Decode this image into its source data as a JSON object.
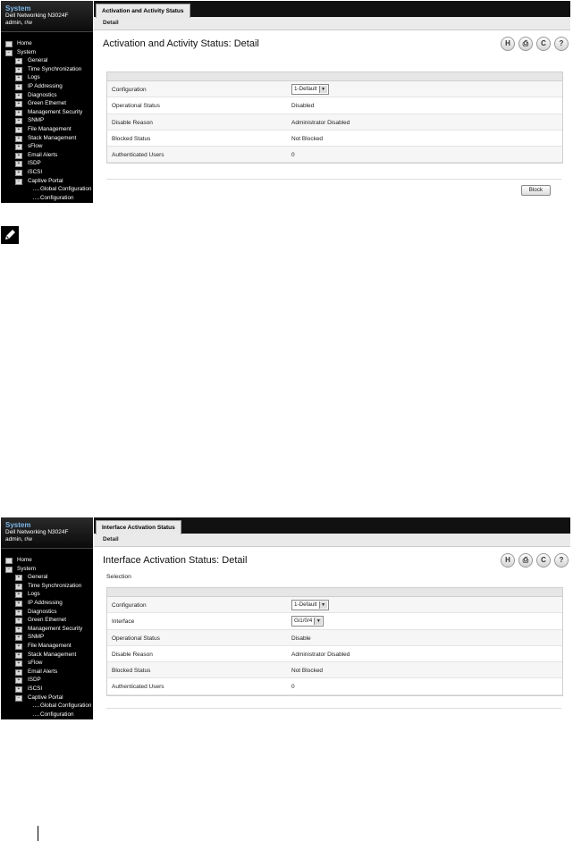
{
  "screens": [
    {
      "sidebar": {
        "title": "System",
        "device": "Dell Networking N3024F",
        "user": "admin, r/w",
        "items": [
          {
            "label": "Home",
            "level": 0,
            "icon": "home-icon"
          },
          {
            "label": "System",
            "level": 0,
            "icon": "minus-icon"
          },
          {
            "label": "General",
            "level": 1,
            "icon": "plus-icon"
          },
          {
            "label": "Time Synchronization",
            "level": 1,
            "icon": "plus-icon"
          },
          {
            "label": "Logs",
            "level": 1,
            "icon": "plus-icon"
          },
          {
            "label": "IP Addressing",
            "level": 1,
            "icon": "plus-icon"
          },
          {
            "label": "Diagnostics",
            "level": 1,
            "icon": "plus-icon"
          },
          {
            "label": "Green Ethernet",
            "level": 1,
            "icon": "plus-icon"
          },
          {
            "label": "Management Security",
            "level": 1,
            "icon": "plus-icon"
          },
          {
            "label": "SNMP",
            "level": 1,
            "icon": "plus-icon"
          },
          {
            "label": "File Management",
            "level": 1,
            "icon": "plus-icon"
          },
          {
            "label": "Stack Management",
            "level": 1,
            "icon": "plus-icon"
          },
          {
            "label": "sFlow",
            "level": 1,
            "icon": "plus-icon"
          },
          {
            "label": "Email Alerts",
            "level": 1,
            "icon": "plus-icon"
          },
          {
            "label": "ISDP",
            "level": 1,
            "icon": "plus-icon"
          },
          {
            "label": "iSCSI",
            "level": 1,
            "icon": "plus-icon"
          },
          {
            "label": "Captive Portal",
            "level": 1,
            "icon": "minus-icon"
          },
          {
            "label": "Global Configuration",
            "level": 2,
            "icon": ""
          },
          {
            "label": "Configuration",
            "level": 2,
            "icon": ""
          }
        ]
      },
      "tab": "Activation and Activity Status",
      "subtab": "Detail",
      "page_title": "Activation and Activity Status: Detail",
      "section_label": "",
      "rows": [
        {
          "key": "Configuration",
          "value": "1-Default",
          "type": "select"
        },
        {
          "key": "Operational Status",
          "value": "Disabled",
          "type": "text"
        },
        {
          "key": "Disable Reason",
          "value": "Administrator Disabled",
          "type": "text"
        },
        {
          "key": "Blocked Status",
          "value": "Not Blocked",
          "type": "text"
        },
        {
          "key": "Authenticated Users",
          "value": "0",
          "type": "text"
        }
      ],
      "button": "Block"
    },
    {
      "sidebar": {
        "title": "System",
        "device": "Dell Networking N3024F",
        "user": "admin, r/w",
        "items": [
          {
            "label": "Home",
            "level": 0,
            "icon": "home-icon"
          },
          {
            "label": "System",
            "level": 0,
            "icon": "minus-icon"
          },
          {
            "label": "General",
            "level": 1,
            "icon": "plus-icon"
          },
          {
            "label": "Time Synchronization",
            "level": 1,
            "icon": "plus-icon"
          },
          {
            "label": "Logs",
            "level": 1,
            "icon": "plus-icon"
          },
          {
            "label": "IP Addressing",
            "level": 1,
            "icon": "plus-icon"
          },
          {
            "label": "Diagnostics",
            "level": 1,
            "icon": "plus-icon"
          },
          {
            "label": "Green Ethernet",
            "level": 1,
            "icon": "plus-icon"
          },
          {
            "label": "Management Security",
            "level": 1,
            "icon": "plus-icon"
          },
          {
            "label": "SNMP",
            "level": 1,
            "icon": "plus-icon"
          },
          {
            "label": "File Management",
            "level": 1,
            "icon": "plus-icon"
          },
          {
            "label": "Stack Management",
            "level": 1,
            "icon": "plus-icon"
          },
          {
            "label": "sFlow",
            "level": 1,
            "icon": "plus-icon"
          },
          {
            "label": "Email Alerts",
            "level": 1,
            "icon": "plus-icon"
          },
          {
            "label": "ISDP",
            "level": 1,
            "icon": "plus-icon"
          },
          {
            "label": "iSCSI",
            "level": 1,
            "icon": "plus-icon"
          },
          {
            "label": "Captive Portal",
            "level": 1,
            "icon": "minus-icon"
          },
          {
            "label": "Global Configuration",
            "level": 2,
            "icon": ""
          },
          {
            "label": "Configuration",
            "level": 2,
            "icon": ""
          }
        ]
      },
      "tab": "Interface Activation Status",
      "subtab": "Detail",
      "page_title": "Interface Activation Status: Detail",
      "section_label": "Selection",
      "rows": [
        {
          "key": "Configuration",
          "value": "1-Default",
          "type": "select"
        },
        {
          "key": "Interface",
          "value": "Gi1/0/4",
          "type": "select"
        },
        {
          "key": "Operational Status",
          "value": "Disable",
          "type": "text"
        },
        {
          "key": "Disable Reason",
          "value": "Administrator Disabled",
          "type": "text"
        },
        {
          "key": "Blocked Status",
          "value": "Not Blocked",
          "type": "text"
        },
        {
          "key": "Authenticated Users",
          "value": "0",
          "type": "text"
        }
      ],
      "button": ""
    }
  ],
  "toolbar_icons": [
    {
      "name": "save-icon",
      "glyph": "H"
    },
    {
      "name": "print-icon",
      "glyph": "⎙"
    },
    {
      "name": "refresh-icon",
      "glyph": "C"
    },
    {
      "name": "help-icon",
      "glyph": "?"
    }
  ],
  "note_icon": "note-pencil-icon"
}
